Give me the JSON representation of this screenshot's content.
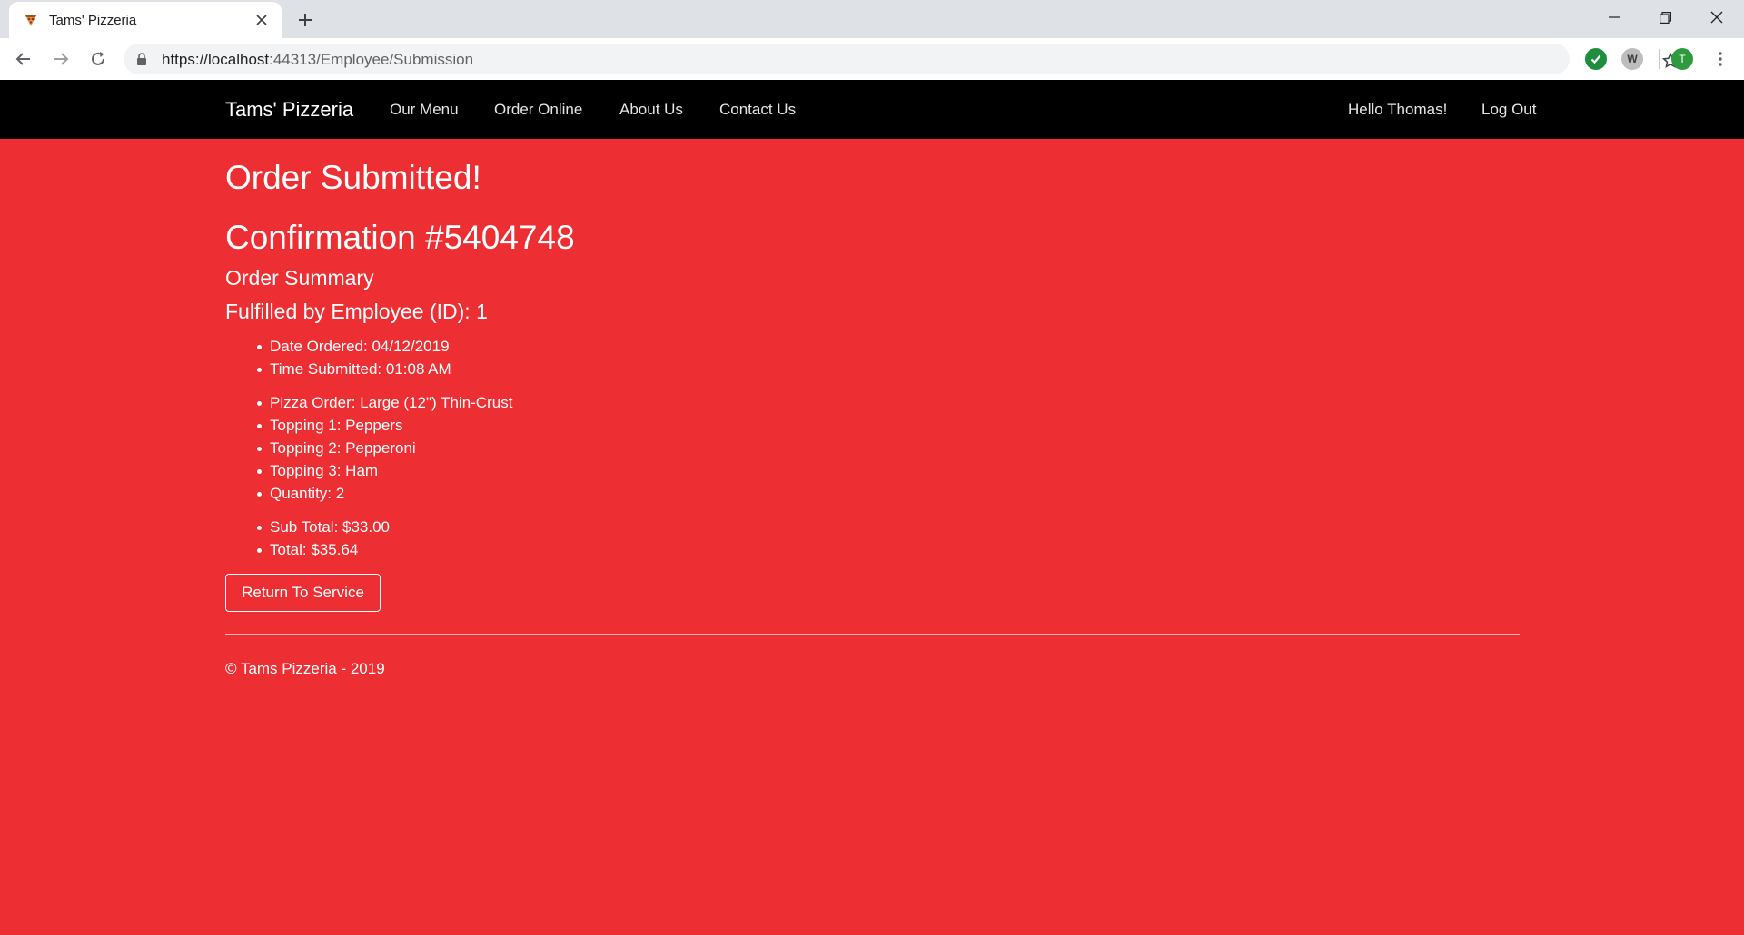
{
  "browser": {
    "tab_title": "Tams' Pizzeria",
    "url_host": "https://localhost",
    "url_rest": ":44313/Employee/Submission",
    "profile_initial": "T",
    "extension_w_label": "W"
  },
  "site": {
    "brand": "Tams' Pizzeria",
    "nav": [
      "Our Menu",
      "Order Online",
      "About Us",
      "Contact Us"
    ],
    "greeting": "Hello Thomas!",
    "logout": "Log Out"
  },
  "order": {
    "heading": "Order Submitted!",
    "confirmation": "Confirmation #5404748",
    "summary_heading": "Order Summary",
    "employee_line": "Fulfilled by Employee (ID): 1",
    "details_when": [
      "Date Ordered: 04/12/2019",
      "Time Submitted: 01:08 AM"
    ],
    "details_items": [
      "Pizza Order: Large (12\") Thin-Crust",
      "Topping 1: Peppers",
      "Topping 2: Pepperoni",
      "Topping 3: Ham",
      "Quantity: 2"
    ],
    "details_totals": [
      "Sub Total: $33.00",
      "Total: $35.64"
    ],
    "return_button": "Return To Service"
  },
  "footer": {
    "text": "© Tams Pizzeria - 2019"
  },
  "colors": {
    "page_background": "#ed2e32",
    "navbar_background": "#000000",
    "text": "#ffffff"
  }
}
